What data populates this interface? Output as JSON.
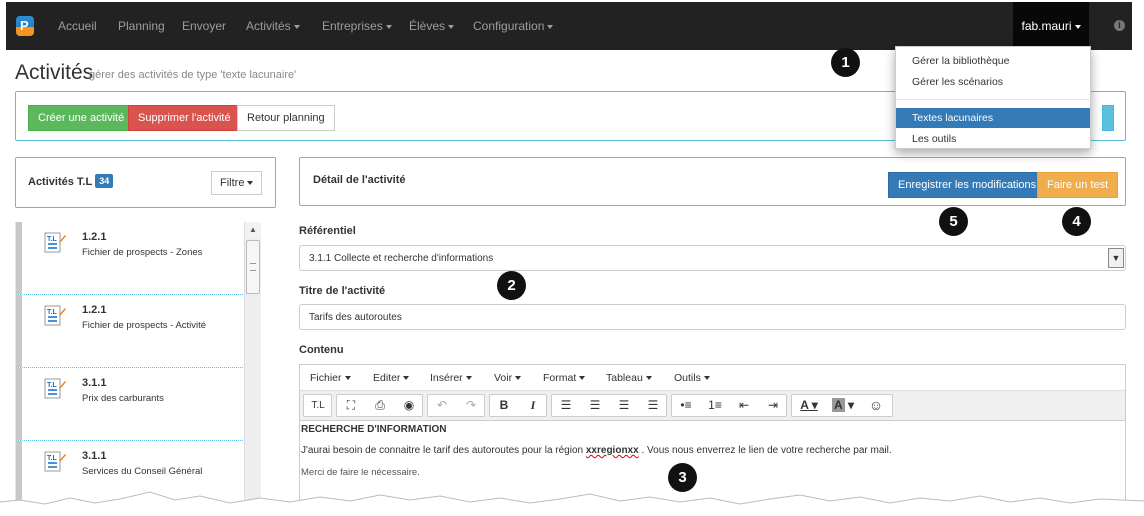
{
  "navbar": {
    "logo_letter": "P",
    "items": [
      "Accueil",
      "Planning",
      "Envoyer",
      "Activités",
      "Entreprises",
      "Élèves",
      "Configuration"
    ],
    "user": "fab.mauri",
    "info_icon": "i"
  },
  "user_menu": {
    "items": [
      "Gérer la bibliothèque",
      "Gérer les scénarios",
      "Textes lacunaires",
      "Les outils"
    ],
    "active_index": 2
  },
  "page": {
    "title": "Activités",
    "subtitle": "gérer des activités de type 'texte lacunaire'"
  },
  "actions": {
    "create": "Créer une activité",
    "delete": "Supprimer l'activité",
    "back": "Retour planning"
  },
  "left_panel": {
    "title": "Activités T.L",
    "count": "34",
    "filter": "Filtre",
    "items": [
      {
        "code": "1.2.1",
        "name": "Fichier de prospects - Zones"
      },
      {
        "code": "1.2.1",
        "name": "Fichier de prospects - Activité"
      },
      {
        "code": "3.1.1",
        "name": "Prix des carburants"
      },
      {
        "code": "3.1.1",
        "name": "Services du Conseil Général"
      }
    ]
  },
  "detail": {
    "title": "Détail de l'activité",
    "save": "Enregistrer les modifications",
    "test": "Faire un test",
    "ref_label": "Référentiel",
    "ref_value": "3.1.1 Collecte et recherche d'informations",
    "name_label": "Titre de l'activité",
    "name_value": "Tarifs des autoroutes",
    "content_label": "Contenu"
  },
  "editor": {
    "menus": [
      "Fichier",
      "Editer",
      "Insérer",
      "Voir",
      "Format",
      "Tableau",
      "Outils"
    ],
    "tl_button": "T.L",
    "heading": "RECHERCHE D'INFORMATION",
    "line1_before": "J'aurai besoin de connaitre le tarif des autoroutes pour la région ",
    "line1_var": "xxregionxx",
    "line1_after": " . Vous nous enverrez le lien de votre recherche par mail.",
    "line2": "Merci de faire le nécessaire."
  },
  "callouts": [
    "1",
    "2",
    "3",
    "4",
    "5"
  ],
  "colors": {
    "navbar": "#222222",
    "primary": "#337ab7",
    "success": "#5cb85c",
    "danger": "#d9534f",
    "warning": "#f0ad4e",
    "info": "#5bc0de"
  }
}
